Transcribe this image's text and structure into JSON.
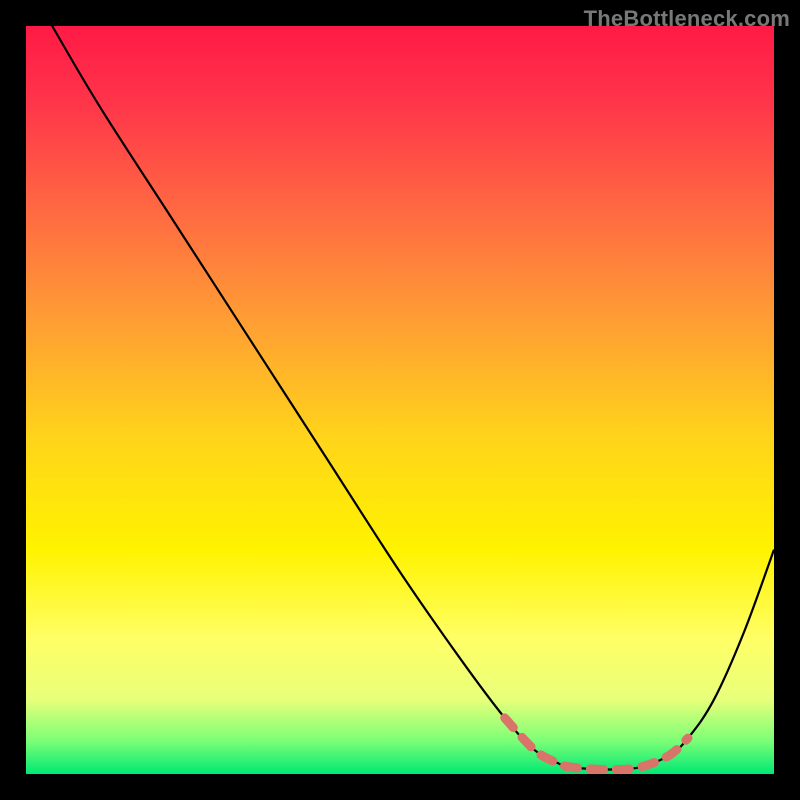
{
  "watermark": "TheBottleneck.com",
  "chart_data": {
    "type": "line",
    "title": "",
    "xlabel": "",
    "ylabel": "",
    "xlim": [
      0,
      100
    ],
    "ylim": [
      0,
      100
    ],
    "grid": false,
    "legend": false,
    "background_gradient_stops": [
      {
        "offset": 0.0,
        "color": "#ff1a46"
      },
      {
        "offset": 0.1,
        "color": "#ff344a"
      },
      {
        "offset": 0.25,
        "color": "#ff6a42"
      },
      {
        "offset": 0.4,
        "color": "#ffa033"
      },
      {
        "offset": 0.55,
        "color": "#ffd41a"
      },
      {
        "offset": 0.7,
        "color": "#fff300"
      },
      {
        "offset": 0.82,
        "color": "#ffff66"
      },
      {
        "offset": 0.9,
        "color": "#e8ff7a"
      },
      {
        "offset": 0.955,
        "color": "#7dff76"
      },
      {
        "offset": 1.0,
        "color": "#00e874"
      }
    ],
    "series": [
      {
        "name": "bottleneck-curve",
        "color": "#000000",
        "x": [
          3.5,
          10,
          20,
          30,
          40,
          50,
          58,
          64,
          68,
          71,
          73,
          78,
          82,
          86,
          88.5,
          92,
          96,
          100
        ],
        "values": [
          100,
          89,
          73.5,
          58,
          42.5,
          27,
          15.5,
          7.5,
          3.2,
          1.5,
          0.9,
          0.6,
          0.9,
          2.5,
          4.8,
          10,
          19,
          30
        ]
      }
    ],
    "highlight": {
      "name": "optimal-range",
      "color": "#d9746a",
      "stroke_width": 9,
      "dash": [
        13,
        13
      ],
      "x": [
        64,
        68,
        71,
        73,
        78,
        82,
        86,
        88.5
      ],
      "values": [
        7.5,
        3.2,
        1.5,
        0.9,
        0.6,
        0.9,
        2.5,
        4.8
      ]
    }
  }
}
